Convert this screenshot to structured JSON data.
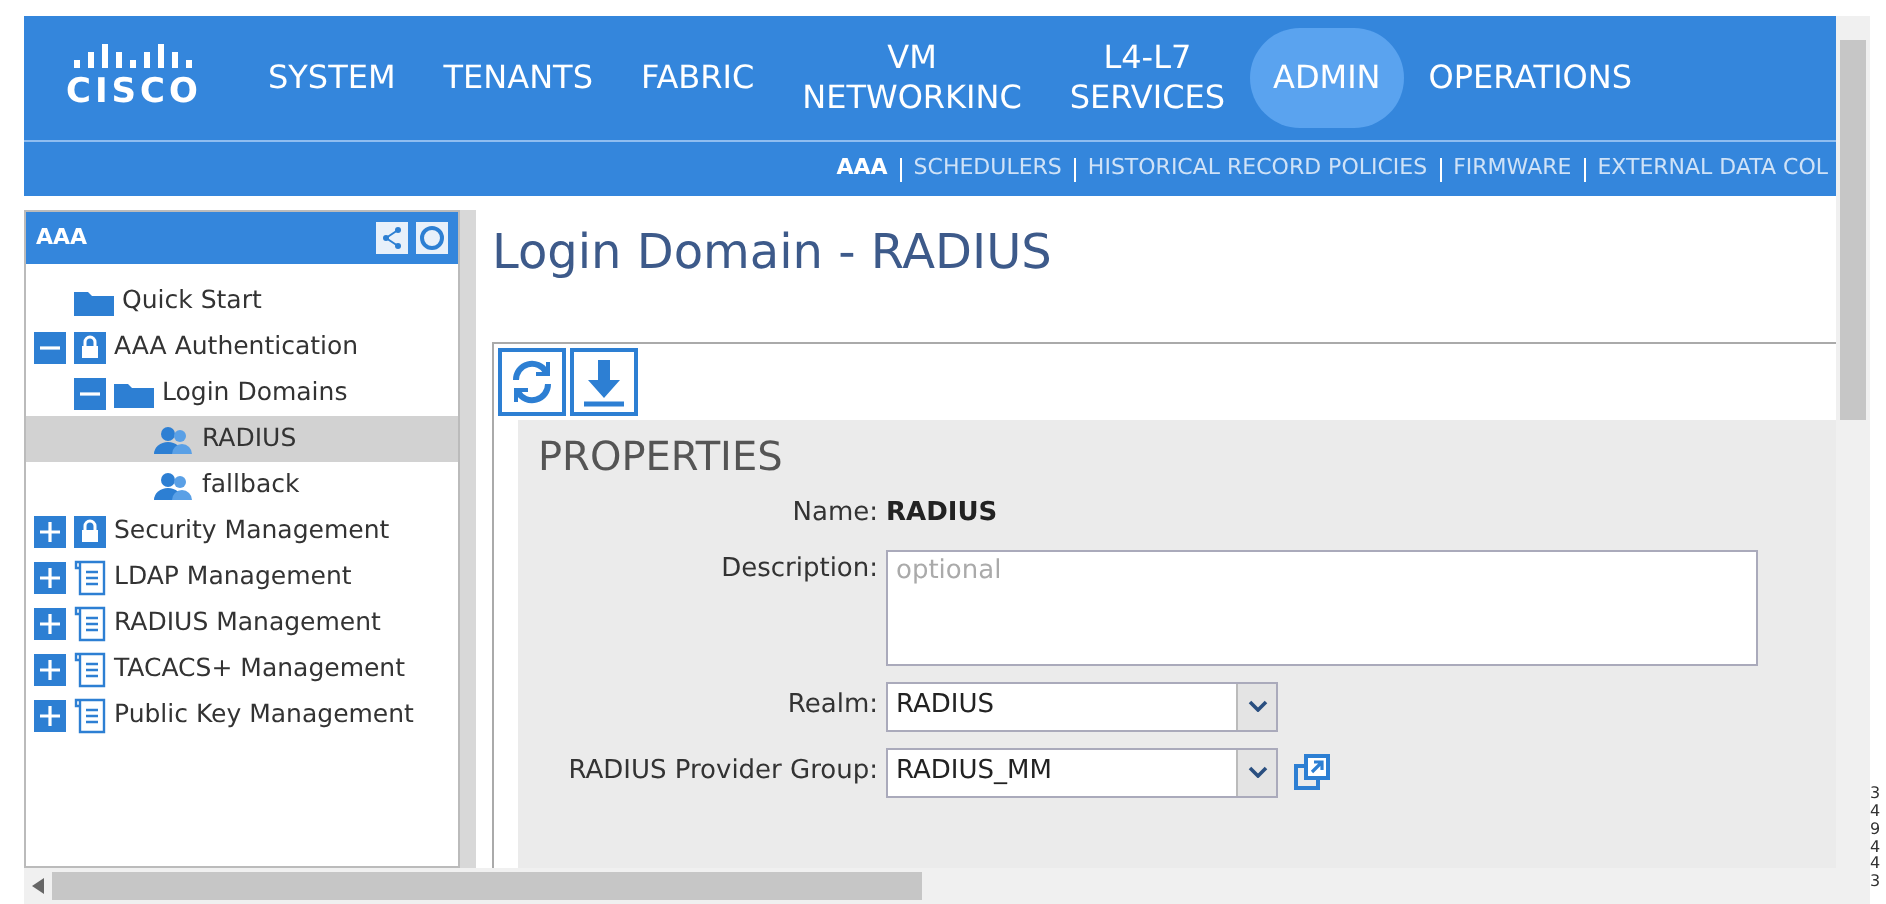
{
  "logo": "CISCO",
  "nav": {
    "tabs": [
      {
        "label": "SYSTEM",
        "selected": false
      },
      {
        "label": "TENANTS",
        "selected": false
      },
      {
        "label": "FABRIC",
        "selected": false
      },
      {
        "label": "VM\nNETWORKINC",
        "selected": false
      },
      {
        "label": "L4-L7\nSERVICES",
        "selected": false
      },
      {
        "label": "ADMIN",
        "selected": true
      },
      {
        "label": "OPERATIONS",
        "selected": false
      }
    ],
    "subtabs": [
      {
        "label": "AAA",
        "selected": true
      },
      {
        "label": "SCHEDULERS",
        "selected": false
      },
      {
        "label": "HISTORICAL RECORD POLICIES",
        "selected": false
      },
      {
        "label": "FIRMWARE",
        "selected": false
      },
      {
        "label": "EXTERNAL DATA COL",
        "selected": false
      }
    ]
  },
  "sidebar": {
    "title": "AAA",
    "items": [
      {
        "label": "Quick Start",
        "kind": "folder",
        "selected": false
      },
      {
        "label": "AAA Authentication",
        "kind": "lock",
        "expanded": true,
        "selected": false,
        "children": [
          {
            "label": "Login Domains",
            "kind": "folder",
            "expanded": true,
            "selected": false,
            "children": [
              {
                "label": "RADIUS",
                "kind": "user",
                "selected": true
              },
              {
                "label": "fallback",
                "kind": "user",
                "selected": false
              }
            ]
          }
        ]
      },
      {
        "label": "Security Management",
        "kind": "lock",
        "expanded": false,
        "selected": false
      },
      {
        "label": "LDAP Management",
        "kind": "doc",
        "expanded": false,
        "selected": false
      },
      {
        "label": "RADIUS Management",
        "kind": "doc",
        "expanded": false,
        "selected": false
      },
      {
        "label": "TACACS+ Management",
        "kind": "doc",
        "expanded": false,
        "selected": false
      },
      {
        "label": "Public Key Management",
        "kind": "doc",
        "expanded": false,
        "selected": false
      }
    ]
  },
  "page": {
    "title": "Login Domain - RADIUS",
    "section": "PROPERTIES",
    "fields": [
      {
        "kind": "static",
        "label": "Name:",
        "value": "RADIUS"
      },
      {
        "kind": "textarea",
        "label": "Description:",
        "placeholder": "optional"
      },
      {
        "kind": "select",
        "label": "Realm:",
        "value": "RADIUS"
      },
      {
        "kind": "select",
        "label": "RADIUS Provider Group:",
        "value": "RADIUS_MM",
        "link": true
      }
    ]
  },
  "figure_id": "349443"
}
